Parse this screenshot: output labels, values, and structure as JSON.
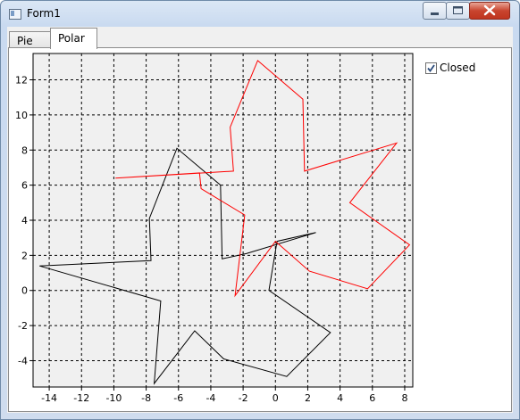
{
  "window": {
    "title": "Form1"
  },
  "tabs": [
    {
      "label": "Pie",
      "selected": false
    },
    {
      "label": "Polar",
      "selected": true
    }
  ],
  "options": {
    "closed_label": "Closed",
    "closed_checked": true
  },
  "chart_data": {
    "type": "line",
    "grid": true,
    "xlim": [
      -15,
      8.5
    ],
    "ylim": [
      -5.5,
      13.5
    ],
    "x_ticks": [
      -14,
      -12,
      -10,
      -8,
      -6,
      -4,
      -2,
      0,
      2,
      4,
      6,
      8
    ],
    "y_ticks": [
      -4,
      -2,
      0,
      2,
      4,
      6,
      8,
      10,
      12
    ],
    "series": [
      {
        "color": "#000000",
        "closed": true,
        "points": [
          [
            2.5,
            3.3
          ],
          [
            -1.8,
            2.1
          ],
          [
            -3.3,
            1.8
          ],
          [
            -3.4,
            6.0
          ],
          [
            -6.1,
            8.1
          ],
          [
            -7.8,
            4.1
          ],
          [
            -7.7,
            1.7
          ],
          [
            -14.6,
            1.4
          ],
          [
            -7.1,
            -0.6
          ],
          [
            -7.5,
            -5.3
          ],
          [
            -5.0,
            -2.3
          ],
          [
            -3.2,
            -3.9
          ],
          [
            0.7,
            -4.9
          ],
          [
            3.4,
            -2.4
          ],
          [
            -0.4,
            0.0
          ],
          [
            0.1,
            2.8
          ]
        ]
      },
      {
        "color": "#ff0000",
        "closed": true,
        "points": [
          [
            -1.1,
            13.1
          ],
          [
            1.7,
            10.9
          ],
          [
            1.8,
            6.8
          ],
          [
            7.5,
            8.4
          ],
          [
            4.6,
            5.0
          ],
          [
            8.3,
            2.6
          ],
          [
            5.7,
            0.1
          ],
          [
            2.1,
            1.1
          ],
          [
            0.0,
            2.8
          ],
          [
            -2.5,
            -0.3
          ],
          [
            -1.9,
            4.3
          ],
          [
            -4.6,
            5.8
          ],
          [
            -4.7,
            6.7
          ],
          [
            -9.9,
            6.4
          ],
          [
            -2.6,
            6.8
          ],
          [
            -2.8,
            9.3
          ]
        ]
      }
    ]
  }
}
